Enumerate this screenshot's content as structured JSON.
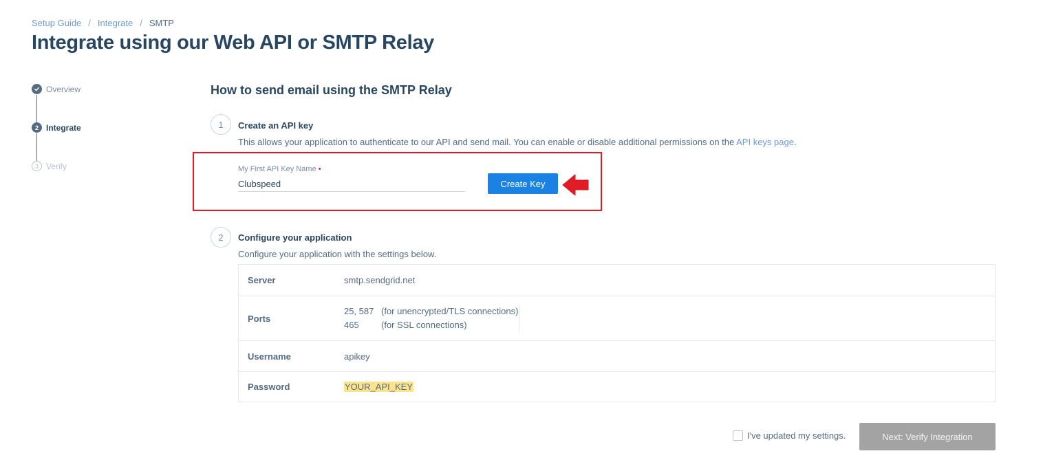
{
  "breadcrumb": {
    "items": [
      "Setup Guide",
      "Integrate"
    ],
    "separator": "/",
    "current": "SMTP"
  },
  "page_title": "Integrate using our Web API or SMTP Relay",
  "stepper": {
    "steps": [
      {
        "label": "Overview",
        "state": "complete",
        "marker": "check-icon"
      },
      {
        "label": "Integrate",
        "state": "active",
        "marker": "2"
      },
      {
        "label": "Verify",
        "state": "pending",
        "marker": "3"
      }
    ]
  },
  "section_title": "How to send email using the SMTP Relay",
  "step1": {
    "number": "1",
    "title": "Create an API key",
    "description": "This allows your application to authenticate to our API and send mail. You can enable or disable additional permissions on the",
    "link_text": "API keys page",
    "period": ".",
    "field_label": "My First API Key Name",
    "required_marker": "•",
    "field_value": "Clubspeed",
    "button_label": "Create Key"
  },
  "step2": {
    "number": "2",
    "title": "Configure your application",
    "description": "Configure your application with the settings below.",
    "rows": {
      "server": {
        "key": "Server",
        "value": "smtp.sendgrid.net"
      },
      "ports": {
        "key": "Ports",
        "entries": [
          {
            "port": "25, 587",
            "note": "(for unencrypted/TLS connections)"
          },
          {
            "port": "465",
            "note": "(for SSL connections)"
          }
        ]
      },
      "username": {
        "key": "Username",
        "value": "apikey"
      },
      "password": {
        "key": "Password",
        "value": "YOUR_API_KEY"
      }
    }
  },
  "footer": {
    "checkbox_label": "I've updated my settings.",
    "checkbox_checked": false,
    "next_button": "Next: Verify Integration"
  },
  "colors": {
    "primary_button": "#1a82e2",
    "annotation": "#e21c24",
    "highlight": "#fbe48b",
    "disabled_button": "#a3a3a3"
  }
}
